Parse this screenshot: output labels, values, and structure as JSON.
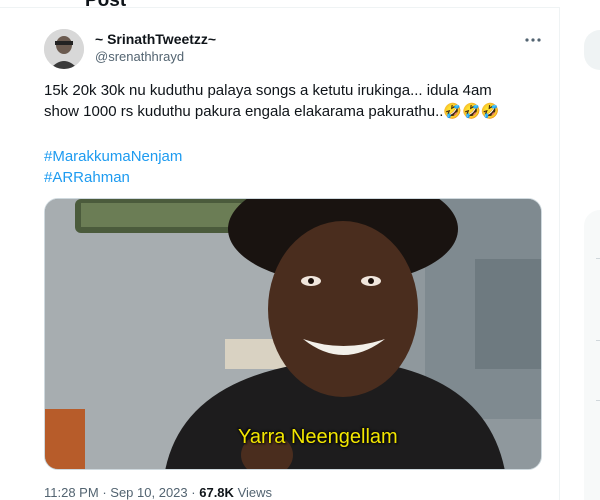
{
  "header": {
    "title": "Post"
  },
  "tweet": {
    "author_name": "~ SrinathTweetzz~",
    "handle": "@srenathhrayd",
    "text_lines": [
      "15k 20k 30k nu kuduthu palaya songs a ketutu irukinga... idula 4am",
      "show 1000 rs kuduthu pakura engala elakarama pakurathu..🤣🤣🤣"
    ],
    "hashtags": [
      "#MarakkumaNenjam",
      "#ARRahman"
    ],
    "media_caption": "Yarra Neengellam",
    "time": "11:28 PM",
    "separator": "·",
    "date": "Sep 10, 2023",
    "views_count": "67.8K",
    "views_label": "Views"
  },
  "icons": {
    "back": "arrow-left-icon",
    "more": "more-horizontal-icon"
  },
  "colors": {
    "link": "#1d9bf0",
    "text": "#0f1419",
    "secondary": "#536471",
    "caption": "#f2e600"
  }
}
